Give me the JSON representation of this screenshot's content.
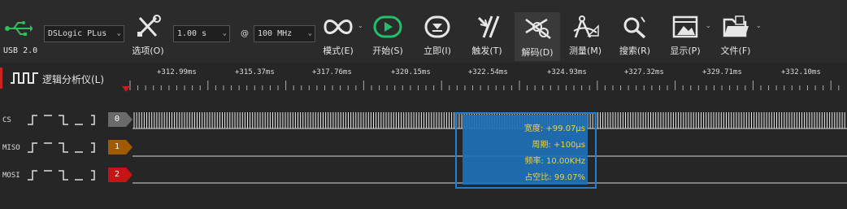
{
  "toolbar": {
    "usb_label": "USB 2.0",
    "device": "DSLogic PLus",
    "options_label": "选项(O)",
    "sample_depth": "1.00 s",
    "at": "@",
    "sample_rate": "100 MHz",
    "mode_label": "模式(E)",
    "start_label": "开始(S)",
    "instant_label": "立即(I)",
    "trigger_label": "触发(T)",
    "decode_label": "解码(D)",
    "measure_label": "测量(M)",
    "search_label": "搜索(R)",
    "display_label": "显示(P)",
    "file_label": "文件(F)",
    "colors": {
      "start_green": "#22c06a",
      "active_bg": "#3a3a3a"
    }
  },
  "ruler": {
    "analyzer_label": "逻辑分析仪(L)",
    "ticks": [
      "+312.99ms",
      "+315.37ms",
      "+317.76ms",
      "+320.15ms",
      "+322.54ms",
      "+324.93ms",
      "+327.32ms",
      "+329.71ms",
      "+332.10ms"
    ]
  },
  "channels": [
    {
      "name": "CS",
      "index": "0",
      "color": "#6a6a6a"
    },
    {
      "name": "MISO",
      "index": "1",
      "color": "#a05a00"
    },
    {
      "name": "MOSI",
      "index": "2",
      "color": "#c41414"
    }
  ],
  "measurement": {
    "width": "宽度: +99.07μs",
    "period": "周期: +100μs",
    "frequency": "频率: 10.00KHz",
    "duty": "占空比: 99.07%"
  }
}
